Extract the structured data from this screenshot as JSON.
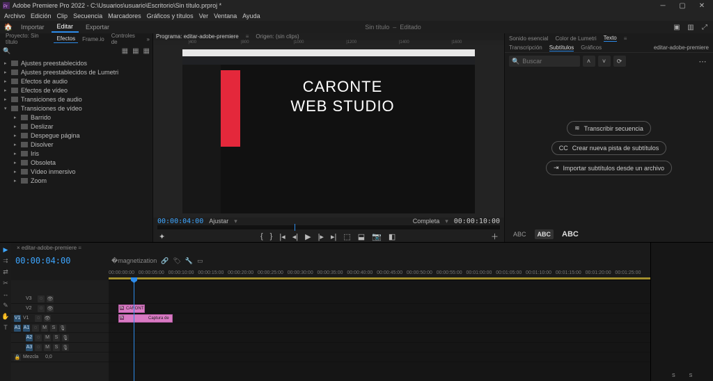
{
  "app": {
    "title": "Adobe Premiere Pro 2022 - C:\\Usuarios\\usuario\\Escritorio\\Sin título.prproj *",
    "doc_title": "Sin título",
    "doc_status": "Editado"
  },
  "menus": [
    "Archivo",
    "Edición",
    "Clip",
    "Secuencia",
    "Marcadores",
    "Gráficos y títulos",
    "Ver",
    "Ventana",
    "Ayuda"
  ],
  "workspace": {
    "import": "Importar",
    "edit": "Editar",
    "export": "Exportar"
  },
  "left": {
    "tabs": [
      "Proyecto: Sin título",
      "Efectos",
      "Frame.io",
      "Controles de"
    ],
    "tree": [
      {
        "lvl": 0,
        "label": "Ajustes preestablecidos",
        "exp": true
      },
      {
        "lvl": 0,
        "label": "Ajustes preestablecidos de Lumetri",
        "exp": true
      },
      {
        "lvl": 0,
        "label": "Efectos de audio",
        "exp": true
      },
      {
        "lvl": 0,
        "label": "Efectos de vídeo",
        "exp": true
      },
      {
        "lvl": 0,
        "label": "Transiciones de audio",
        "exp": true
      },
      {
        "lvl": 0,
        "label": "Transiciones de vídeo",
        "exp": false
      },
      {
        "lvl": 1,
        "label": "Barrido"
      },
      {
        "lvl": 1,
        "label": "Deslizar"
      },
      {
        "lvl": 1,
        "label": "Despegue página"
      },
      {
        "lvl": 1,
        "label": "Disolver"
      },
      {
        "lvl": 1,
        "label": "Iris"
      },
      {
        "lvl": 1,
        "label": "Obsoleta"
      },
      {
        "lvl": 1,
        "label": "Vídeo inmersivo"
      },
      {
        "lvl": 1,
        "label": "Zoom"
      }
    ]
  },
  "program": {
    "label": "Programa: editar-adobe-premiere",
    "origin": "Origen: (sin clips)",
    "overlay_line1": "CARONTE",
    "overlay_line2": "WEB STUDIO",
    "tc_current": "00:00:04:00",
    "fit": "Ajustar",
    "complete": "Completa",
    "tc_duration": "00:00:10:00"
  },
  "right": {
    "tabs_top": [
      "Sonido esencial",
      "Color de Lumetri",
      "Texto"
    ],
    "tabs_sub": [
      "Transcripción",
      "Subtítulos",
      "Gráficos"
    ],
    "seq": "editar-adobe-premiere",
    "search_placeholder": "Buscar",
    "b1": "Transcribir secuencia",
    "b2": "Crear nueva pista de subtítulos",
    "b3": "Importar subtítulos desde un archivo",
    "abc_small": "ABC",
    "abc_mid": "ABC",
    "abc_big": "ABC"
  },
  "timeline": {
    "seq": "editar-adobe-premiere",
    "tc": "00:00:04:00",
    "ruler": [
      "00:00:00:00",
      "00:00:05:00",
      "00:00:10:00",
      "00:00:15:00",
      "00:00:20:00",
      "00:00:25:00",
      "00:00:30:00",
      "00:00:35:00",
      "00:00:40:00",
      "00:00:45:00",
      "00:00:50:00",
      "00:00:55:00",
      "00:01:00:00",
      "00:01:05:00",
      "00:01:10:00",
      "00:01:15:00",
      "00:01:20:00",
      "00:01:25:00"
    ],
    "clip1": "CARONTE",
    "clip2": "Captura de",
    "mix": "Mezcla",
    "mix_val": "0,0",
    "meter_l": "S",
    "meter_r": "S",
    "video_tracks": [
      "V3",
      "V2",
      "V1"
    ],
    "audio_tracks": [
      "A1",
      "A2",
      "A3"
    ]
  }
}
